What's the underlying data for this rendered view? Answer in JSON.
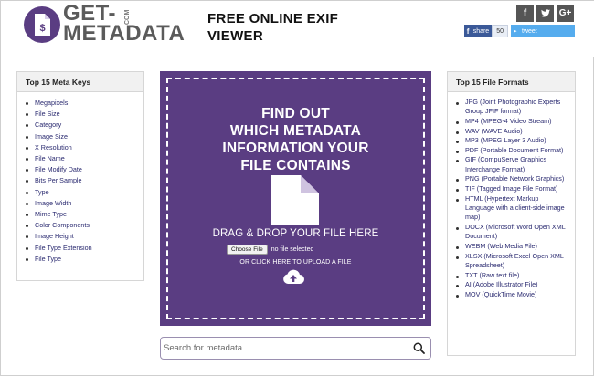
{
  "header": {
    "logo_line1": "GET-",
    "logo_line2": "METADATA",
    "logo_suffix": ".COM",
    "site_title": "FREE ONLINE EXIF VIEWER",
    "social_buttons": [
      {
        "icon": "facebook-icon",
        "glyph": "f"
      },
      {
        "icon": "twitter-icon",
        "glyph": "t"
      },
      {
        "icon": "google-plus-icon",
        "glyph": "G+"
      }
    ],
    "fb_share_label": "share",
    "fb_share_count": "50",
    "tweet_label": "tweet"
  },
  "left_panel": {
    "title": "Top 15 Meta Keys",
    "items": [
      "Megapixels",
      "File Size",
      "Category",
      "Image Size",
      "X Resolution",
      "File Name",
      "File Modify Date",
      "Bits Per Sample",
      "Type",
      "Image Width",
      "Mime Type",
      "Color Components",
      "Image Height",
      "File Type Extension",
      "File Type"
    ]
  },
  "dropzone": {
    "headline": [
      "FIND OUT",
      "WHICH METADATA",
      "INFORMATION YOUR",
      "FILE CONTAINS"
    ],
    "drag_text": "DRAG & DROP YOUR FILE HERE",
    "choose_file_label": "Choose File",
    "no_file_text": "no file selected",
    "click_text": "OR CLICK HERE TO UPLOAD A FILE"
  },
  "search": {
    "placeholder": "Search for metadata"
  },
  "right_panel": {
    "title": "Top 15 File Formats",
    "items": [
      "JPG (Joint Photographic Experts Group JFIF format)",
      "MP4 (MPEG-4 Video Stream)",
      "WAV (WAVE Audio)",
      "MP3 (MPEG Layer 3 Audio)",
      "PDF (Portable Document Format)",
      "GIF (CompuServe Graphics Interchange Format)",
      "PNG (Portable Network Graphics)",
      "TIF (Tagged Image File Format)",
      "HTML (Hypertext Markup Language with a client-side image map)",
      "DOCX (Microsoft Word Open XML Document)",
      "WEBM (Web Media File)",
      "XLSX (Microsoft Excel Open XML Spreadsheet)",
      "TXT (Raw text file)",
      "AI (Adobe Illustrator File)",
      "MOV (QuickTime Movie)"
    ]
  },
  "colors": {
    "brand_purple": "#5a3d82",
    "panel_header": "#f1f1f1",
    "link_text": "#2a2a70",
    "facebook": "#3b5998",
    "twitter": "#55acee"
  }
}
